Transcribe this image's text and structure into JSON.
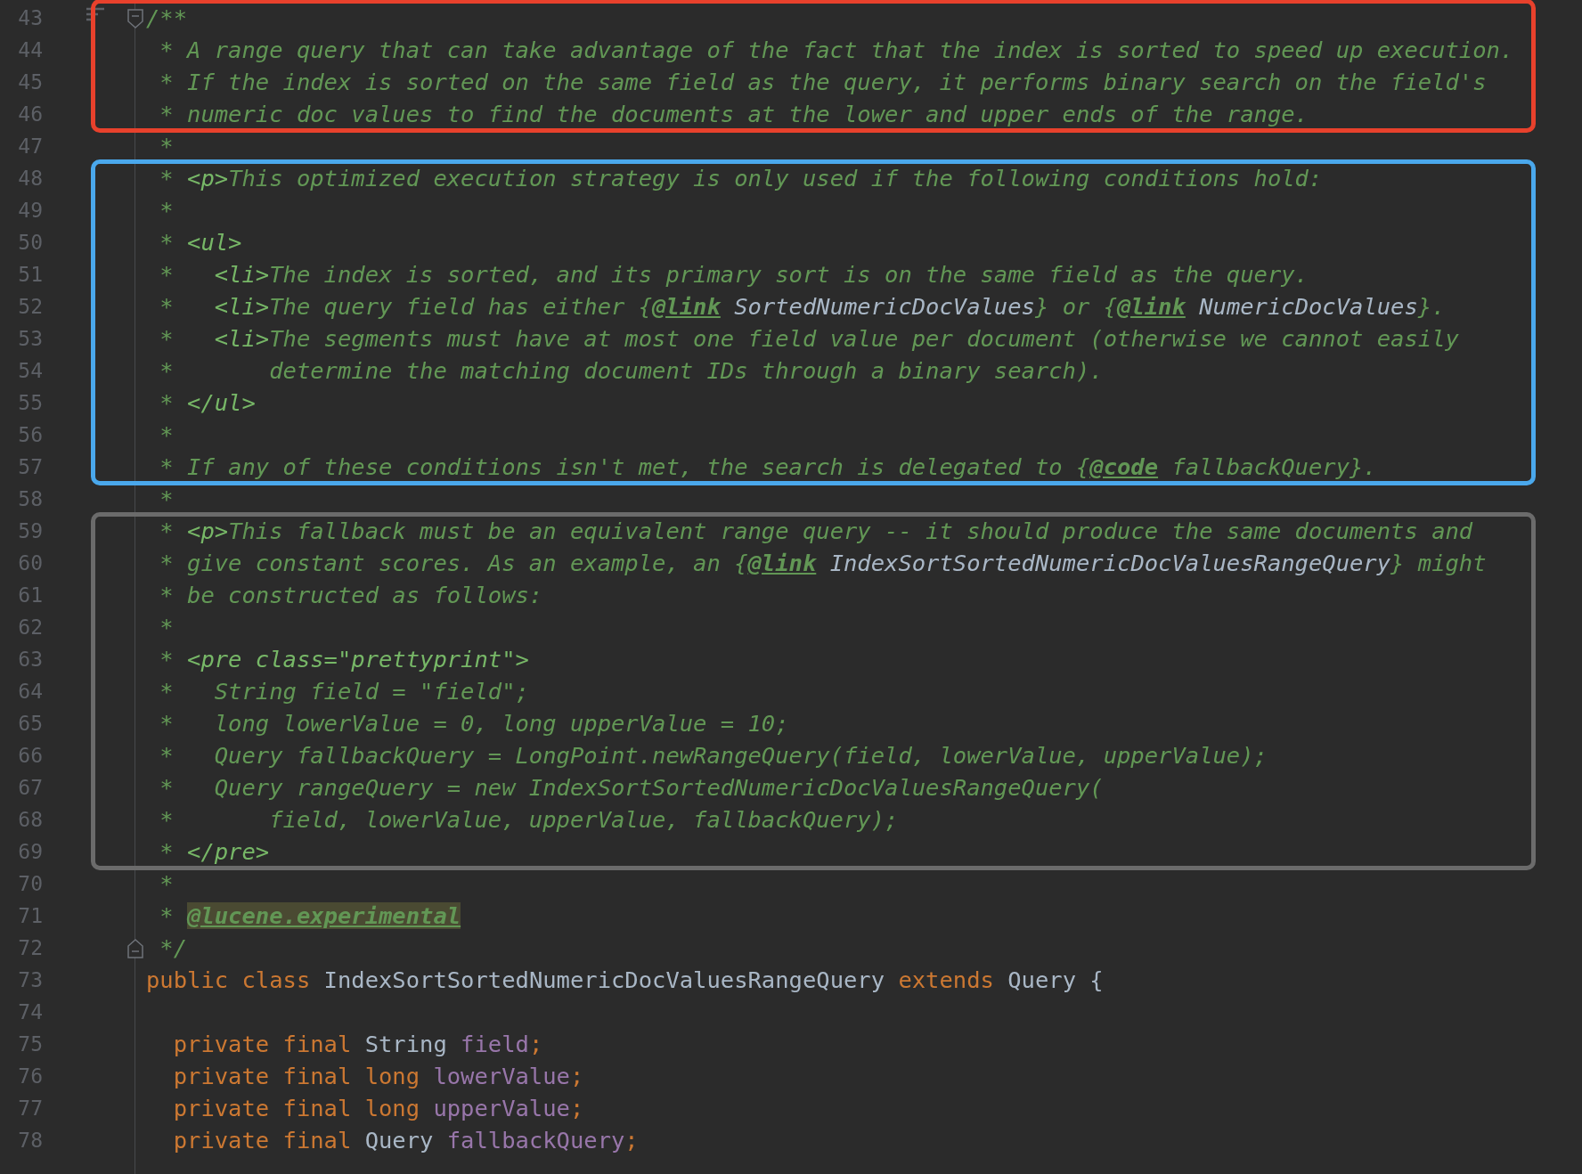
{
  "editor": {
    "sections": [
      {
        "color": "#e8412c",
        "lines": [
          {
            "number": "43",
            "fold_start": true,
            "reader_toggle": true,
            "tokens": [
              {
                "kind": "comment",
                "text": "/**"
              }
            ]
          },
          {
            "number": "44",
            "tokens": [
              {
                "kind": "comment",
                "text": " * A range query that can take advantage of the fact that the index is sorted to speed up execution."
              }
            ]
          },
          {
            "number": "45",
            "tokens": [
              {
                "kind": "comment",
                "text": " * If the index is sorted on the same field as the query, it performs binary search on the field's"
              }
            ]
          },
          {
            "number": "46",
            "tokens": [
              {
                "kind": "comment",
                "text": " * numeric doc values to find the documents at the lower and upper ends of the range."
              }
            ]
          }
        ]
      },
      {
        "lines": [
          {
            "number": "47",
            "tokens": [
              {
                "kind": "comment",
                "text": " *"
              }
            ]
          }
        ]
      },
      {
        "color": "#4aa8ec",
        "lines": [
          {
            "number": "48",
            "tokens": [
              {
                "kind": "comment",
                "text": " * "
              },
              {
                "kind": "tag",
                "text": "<p>"
              },
              {
                "kind": "comment",
                "text": "This optimized execution strategy is only used if the following conditions hold:"
              }
            ]
          },
          {
            "number": "49",
            "tokens": [
              {
                "kind": "comment",
                "text": " *"
              }
            ]
          },
          {
            "number": "50",
            "tokens": [
              {
                "kind": "comment",
                "text": " * "
              },
              {
                "kind": "tag",
                "text": "<ul>"
              }
            ]
          },
          {
            "number": "51",
            "tokens": [
              {
                "kind": "comment",
                "text": " *   "
              },
              {
                "kind": "tag",
                "text": "<li>"
              },
              {
                "kind": "comment",
                "text": "The index is sorted, and its primary sort is on the same field as the query."
              }
            ]
          },
          {
            "number": "52",
            "tokens": [
              {
                "kind": "comment",
                "text": " *   "
              },
              {
                "kind": "tag",
                "text": "<li>"
              },
              {
                "kind": "comment",
                "text": "The query field has either {"
              },
              {
                "kind": "doctag",
                "text": "@link"
              },
              {
                "kind": "ref",
                "text": " SortedNumericDocValues"
              },
              {
                "kind": "comment",
                "text": "} or {"
              },
              {
                "kind": "doctag",
                "text": "@link"
              },
              {
                "kind": "ref",
                "text": " NumericDocValues"
              },
              {
                "kind": "comment",
                "text": "}."
              }
            ]
          },
          {
            "number": "53",
            "tokens": [
              {
                "kind": "comment",
                "text": " *   "
              },
              {
                "kind": "tag",
                "text": "<li>"
              },
              {
                "kind": "comment",
                "text": "The segments must have at most one field value per document (otherwise we cannot easily"
              }
            ]
          },
          {
            "number": "54",
            "tokens": [
              {
                "kind": "comment",
                "text": " *       determine the matching document IDs through a binary search)."
              }
            ]
          },
          {
            "number": "55",
            "tokens": [
              {
                "kind": "comment",
                "text": " * "
              },
              {
                "kind": "tag",
                "text": "</ul>"
              }
            ]
          },
          {
            "number": "56",
            "tokens": [
              {
                "kind": "comment",
                "text": " *"
              }
            ]
          },
          {
            "number": "57",
            "tokens": [
              {
                "kind": "comment",
                "text": " * If any of these conditions isn't met, the search is delegated to {"
              },
              {
                "kind": "doctag",
                "text": "@code"
              },
              {
                "kind": "comment",
                "text": " fallbackQuery}."
              }
            ]
          }
        ]
      },
      {
        "lines": [
          {
            "number": "58",
            "tokens": [
              {
                "kind": "comment",
                "text": " *"
              }
            ]
          }
        ]
      },
      {
        "color": "#6b6b6b",
        "lines": [
          {
            "number": "59",
            "tokens": [
              {
                "kind": "comment",
                "text": " * "
              },
              {
                "kind": "tag",
                "text": "<p>"
              },
              {
                "kind": "comment",
                "text": "This fallback must be an equivalent range query -- it should produce the same documents and"
              }
            ]
          },
          {
            "number": "60",
            "tokens": [
              {
                "kind": "comment",
                "text": " * give constant scores. As an example, an {"
              },
              {
                "kind": "doctag",
                "text": "@link"
              },
              {
                "kind": "ref",
                "text": " IndexSortSortedNumericDocValuesRangeQuery"
              },
              {
                "kind": "comment",
                "text": "} might"
              }
            ]
          },
          {
            "number": "61",
            "tokens": [
              {
                "kind": "comment",
                "text": " * be constructed as follows:"
              }
            ]
          },
          {
            "number": "62",
            "tokens": [
              {
                "kind": "comment",
                "text": " *"
              }
            ]
          },
          {
            "number": "63",
            "tokens": [
              {
                "kind": "comment",
                "text": " * "
              },
              {
                "kind": "tag",
                "text": "<pre class=\"prettyprint\">"
              }
            ]
          },
          {
            "number": "64",
            "tokens": [
              {
                "kind": "comment",
                "text": " *   String field = \"field\";"
              }
            ]
          },
          {
            "number": "65",
            "tokens": [
              {
                "kind": "comment",
                "text": " *   long lowerValue = 0, long upperValue = 10;"
              }
            ]
          },
          {
            "number": "66",
            "tokens": [
              {
                "kind": "comment",
                "text": " *   Query fallbackQuery = LongPoint.newRangeQuery(field, lowerValue, upperValue);"
              }
            ]
          },
          {
            "number": "67",
            "tokens": [
              {
                "kind": "comment",
                "text": " *   Query rangeQuery = new IndexSortSortedNumericDocValuesRangeQuery("
              }
            ]
          },
          {
            "number": "68",
            "tokens": [
              {
                "kind": "comment",
                "text": " *       field, lowerValue, upperValue, fallbackQuery);"
              }
            ]
          },
          {
            "number": "69",
            "tokens": [
              {
                "kind": "comment",
                "text": " * "
              },
              {
                "kind": "tag",
                "text": "</pre>"
              }
            ]
          }
        ]
      },
      {
        "lines": [
          {
            "number": "70",
            "tokens": [
              {
                "kind": "comment",
                "text": " *"
              }
            ]
          },
          {
            "number": "71",
            "tokens": [
              {
                "kind": "comment",
                "text": " * "
              },
              {
                "kind": "annotation",
                "text": "@lucene.experimental"
              }
            ]
          },
          {
            "number": "72",
            "fold_end": true,
            "tokens": [
              {
                "kind": "comment",
                "text": " */"
              }
            ]
          },
          {
            "number": "73",
            "tokens": [
              {
                "kind": "keyword",
                "text": "public class "
              },
              {
                "kind": "ident",
                "text": "IndexSortSortedNumericDocValuesRangeQuery "
              },
              {
                "kind": "keyword",
                "text": "extends "
              },
              {
                "kind": "ident",
                "text": "Query {"
              }
            ]
          },
          {
            "number": "74"
          },
          {
            "number": "75",
            "tokens": [
              {
                "kind": "keyword",
                "text": "  private final "
              },
              {
                "kind": "ident",
                "text": "String "
              },
              {
                "kind": "field",
                "text": "field"
              },
              {
                "kind": "keyword",
                "text": ";"
              }
            ]
          },
          {
            "number": "76",
            "tokens": [
              {
                "kind": "keyword",
                "text": "  private final long "
              },
              {
                "kind": "field",
                "text": "lowerValue"
              },
              {
                "kind": "keyword",
                "text": ";"
              }
            ]
          },
          {
            "number": "77",
            "tokens": [
              {
                "kind": "keyword",
                "text": "  private final long "
              },
              {
                "kind": "field",
                "text": "upperValue"
              },
              {
                "kind": "keyword",
                "text": ";"
              }
            ]
          },
          {
            "number": "78",
            "tokens": [
              {
                "kind": "keyword",
                "text": "  private final "
              },
              {
                "kind": "ident",
                "text": "Query "
              },
              {
                "kind": "field",
                "text": "fallbackQuery"
              },
              {
                "kind": "keyword",
                "text": ";"
              }
            ]
          }
        ]
      }
    ]
  }
}
